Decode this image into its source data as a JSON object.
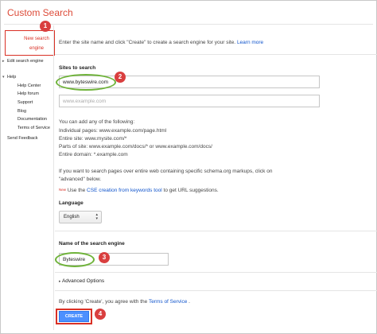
{
  "app": {
    "title": "Custom Search"
  },
  "sidebar": {
    "new_search_engine": "New search engine",
    "edit_search_engine": "Edit search engine",
    "help": "Help",
    "help_items": [
      "Help Center",
      "Help forum",
      "Support",
      "Blog",
      "Documentation",
      "Terms of Service"
    ],
    "send_feedback": "Send Feedback"
  },
  "intro": {
    "text": "Enter the site name and click \"Create\" to create a search engine for your site.",
    "learn_more": "Learn more"
  },
  "sites": {
    "heading": "Sites to search",
    "site_value": "www.byteswire.com",
    "site_placeholder": "www.example.com",
    "add_any": "You can add any of the following:",
    "examples": [
      "Individual pages: www.example.com/page.html",
      "Entire site: www.mysite.com/*",
      "Parts of site: www.example.com/docs/* or www.example.com/docs/",
      "Entire domain: *.example.com"
    ],
    "schema_line1": "If you want to search pages over entire web containing specific schema.org markups, click on",
    "schema_line2": "\"advanced\" below.",
    "new_tag": "New",
    "use_prefix": "Use the",
    "cse_link": "CSE creation from keywords tool",
    "use_suffix": "to get URL suggestions."
  },
  "language": {
    "heading": "Language",
    "selected": "English"
  },
  "name": {
    "heading": "Name of the search engine",
    "value": "Byteswire"
  },
  "advanced": {
    "label": "Advanced Options"
  },
  "terms": {
    "prefix": "By clicking 'Create', you agree with the",
    "link": "Terms of Service",
    "suffix": "."
  },
  "create": {
    "label": "CREATE"
  },
  "badges": [
    "1",
    "2",
    "3",
    "4"
  ],
  "colors": {
    "accent_red": "#d93025",
    "brand_title": "#dd4b39",
    "highlight_green": "#6fb33a",
    "button_blue": "#4d90fe",
    "link_blue": "#1155cc"
  }
}
